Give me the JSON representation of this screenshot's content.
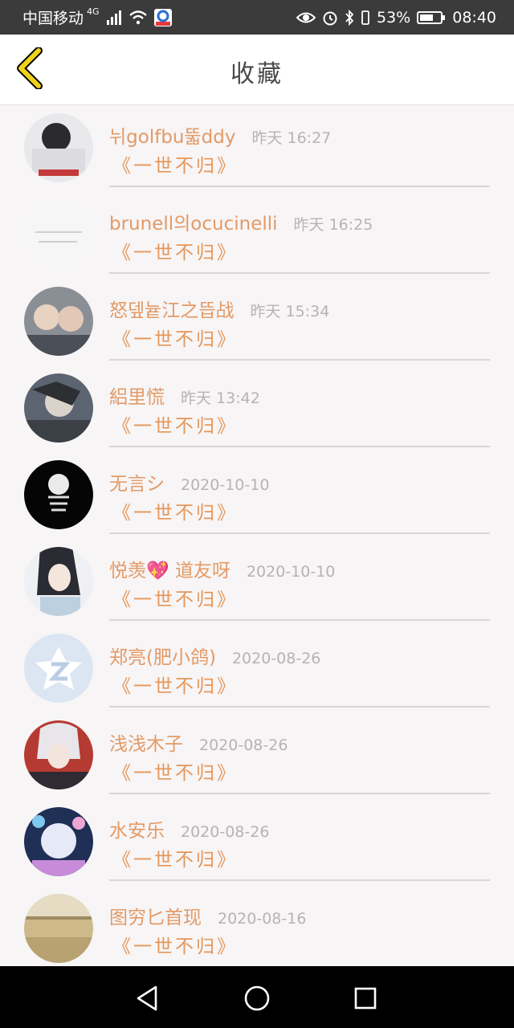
{
  "status_bar": {
    "carrier": "中国移动",
    "network": "4G",
    "battery": "53%",
    "time": "08:40"
  },
  "header": {
    "title": "收藏",
    "back_icon": "chevron-left-icon"
  },
  "colors": {
    "accent": "#e59658",
    "back_icon": "#f0d21a",
    "time_text": "#b7b2b4",
    "divider": "#d9d6d7"
  },
  "favorites": [
    {
      "name": "뉘golfbu뚧ddy",
      "time": "昨天 16:27",
      "title": "《一世不归》"
    },
    {
      "name": "brunell의ocucinelli",
      "time": "昨天 16:25",
      "title": "《一世不归》"
    },
    {
      "name": "怒뎊늍江之뜹战",
      "time": "昨天 15:34",
      "title": "《一世不归》"
    },
    {
      "name": "絽里慌",
      "time": "昨天 13:42",
      "title": "《一世不归》"
    },
    {
      "name": "无言シ",
      "time": "2020-10-10",
      "title": "《一世不归》"
    },
    {
      "name": "悦羡💖 道友呀",
      "time": "2020-10-10",
      "title": "《一世不归》"
    },
    {
      "name": "郑亮(肥小鸽)",
      "time": "2020-08-26",
      "title": "《一世不归》"
    },
    {
      "name": "浅浅木子",
      "time": "2020-08-26",
      "title": "《一世不归》"
    },
    {
      "name": "水安乐",
      "time": "2020-08-26",
      "title": "《一世不归》"
    },
    {
      "name": "图穷匕首现",
      "time": "2020-08-16",
      "title": "《一世不归》"
    }
  ],
  "nav": [
    "back-nav",
    "home-nav",
    "recents-nav"
  ]
}
